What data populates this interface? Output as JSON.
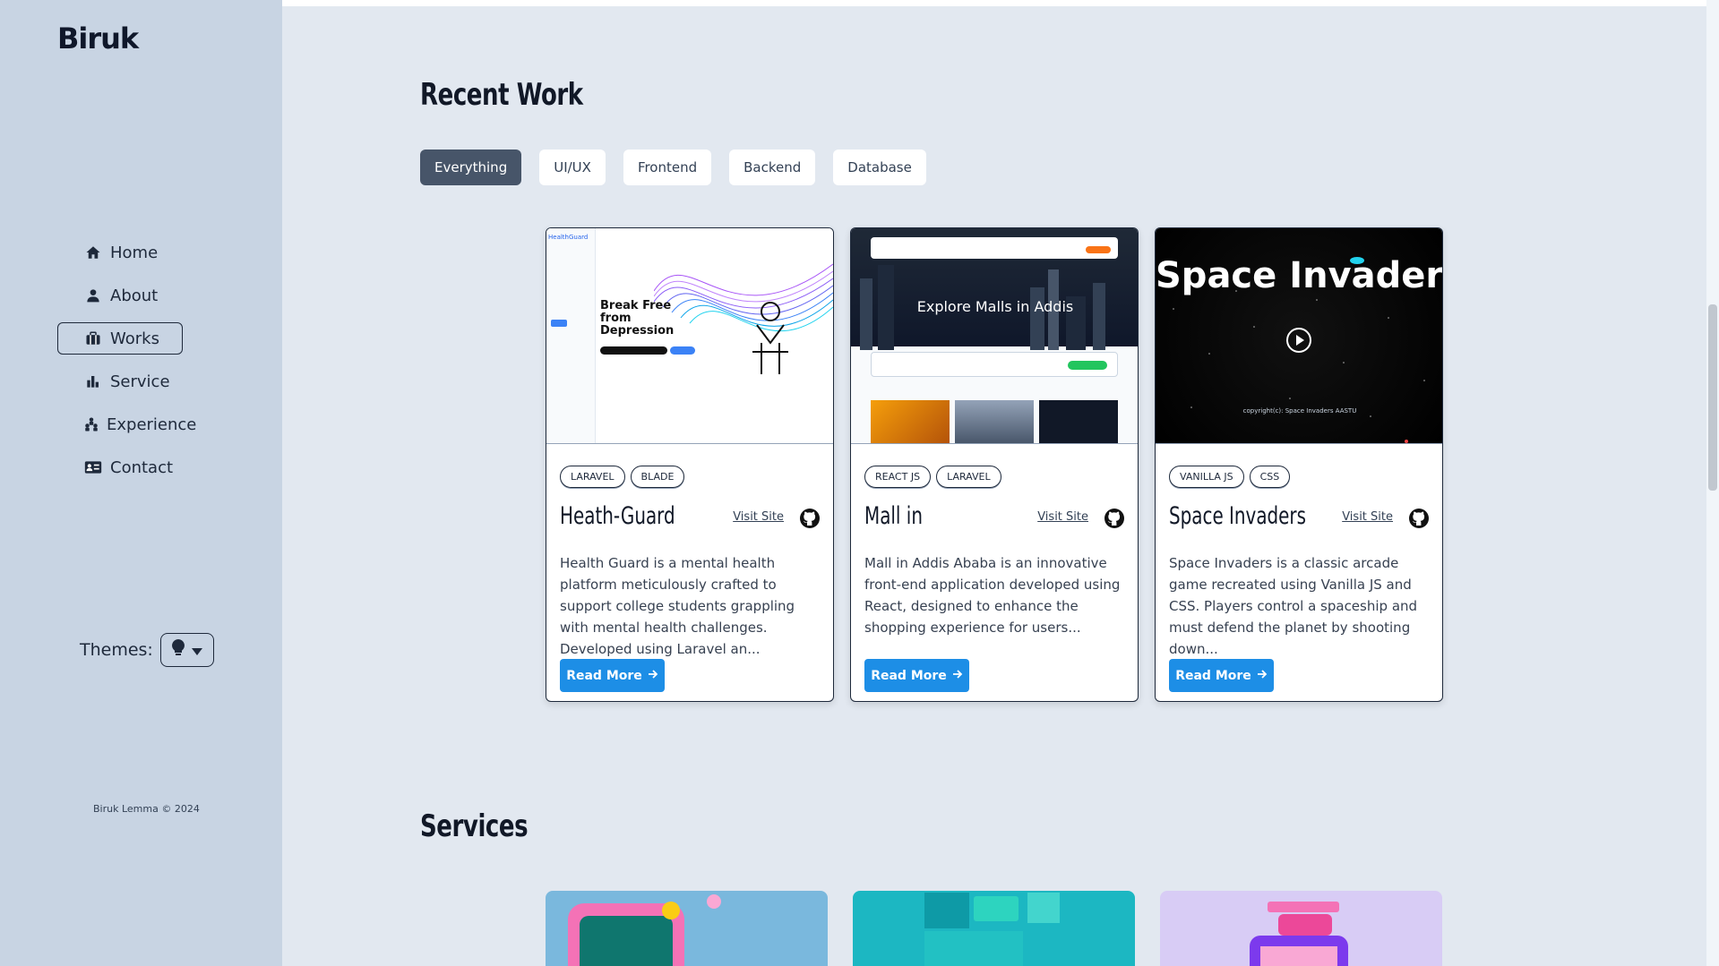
{
  "sidebar": {
    "logo": "Biruk",
    "nav": [
      {
        "label": "Home",
        "icon": "home-icon"
      },
      {
        "label": "About",
        "icon": "user-icon"
      },
      {
        "label": "Works",
        "icon": "briefcase-icon"
      },
      {
        "label": "Service",
        "icon": "chart-icon"
      },
      {
        "label": "Experience",
        "icon": "people-icon"
      },
      {
        "label": "Contact",
        "icon": "contact-card-icon"
      }
    ],
    "active": "Works",
    "themes_label": "Themes:",
    "copyright": "Biruk Lemma © 2024"
  },
  "main": {
    "recent_work_title": "Recent Work",
    "filters": [
      "Everything",
      "UI/UX",
      "Frontend",
      "Backend",
      "Database"
    ],
    "active_filter": "Everything",
    "projects": [
      {
        "tags": [
          "LARAVEL",
          "BLADE"
        ],
        "title": "Heath-Guard",
        "visit": "Visit Site",
        "description": "Health Guard is a mental health platform meticulously crafted to support college students grappling with mental health challenges. Developed using Laravel an...",
        "read_more": "Read More",
        "thumb_heading": "Break Free from Depression",
        "thumb_brand": "HealthGuard"
      },
      {
        "tags": [
          "REACT JS",
          "LARAVEL"
        ],
        "title": "Mall in",
        "visit": "Visit Site",
        "description": "Mall in Addis Ababa is an innovative front-end application developed using React, designed to enhance the shopping experience for users...",
        "read_more": "Read More",
        "thumb_heading": "Explore Malls in Addis"
      },
      {
        "tags": [
          "VANILLA JS",
          "CSS"
        ],
        "title": "Space Invaders",
        "visit": "Visit Site",
        "description": "Space Invaders is a classic arcade game recreated using Vanilla JS and CSS. Players control a spaceship and must defend the planet by shooting down...",
        "read_more": "Read More",
        "thumb_heading": "Space Invaders",
        "thumb_footer": "copyright(c): Space Invaders AASTU"
      }
    ],
    "services_title": "Services"
  },
  "colors": {
    "sidebar_bg": "#c8d4e3",
    "main_bg": "#e2e8f0",
    "accent": "#1d8ee6",
    "active_filter": "#475569"
  }
}
